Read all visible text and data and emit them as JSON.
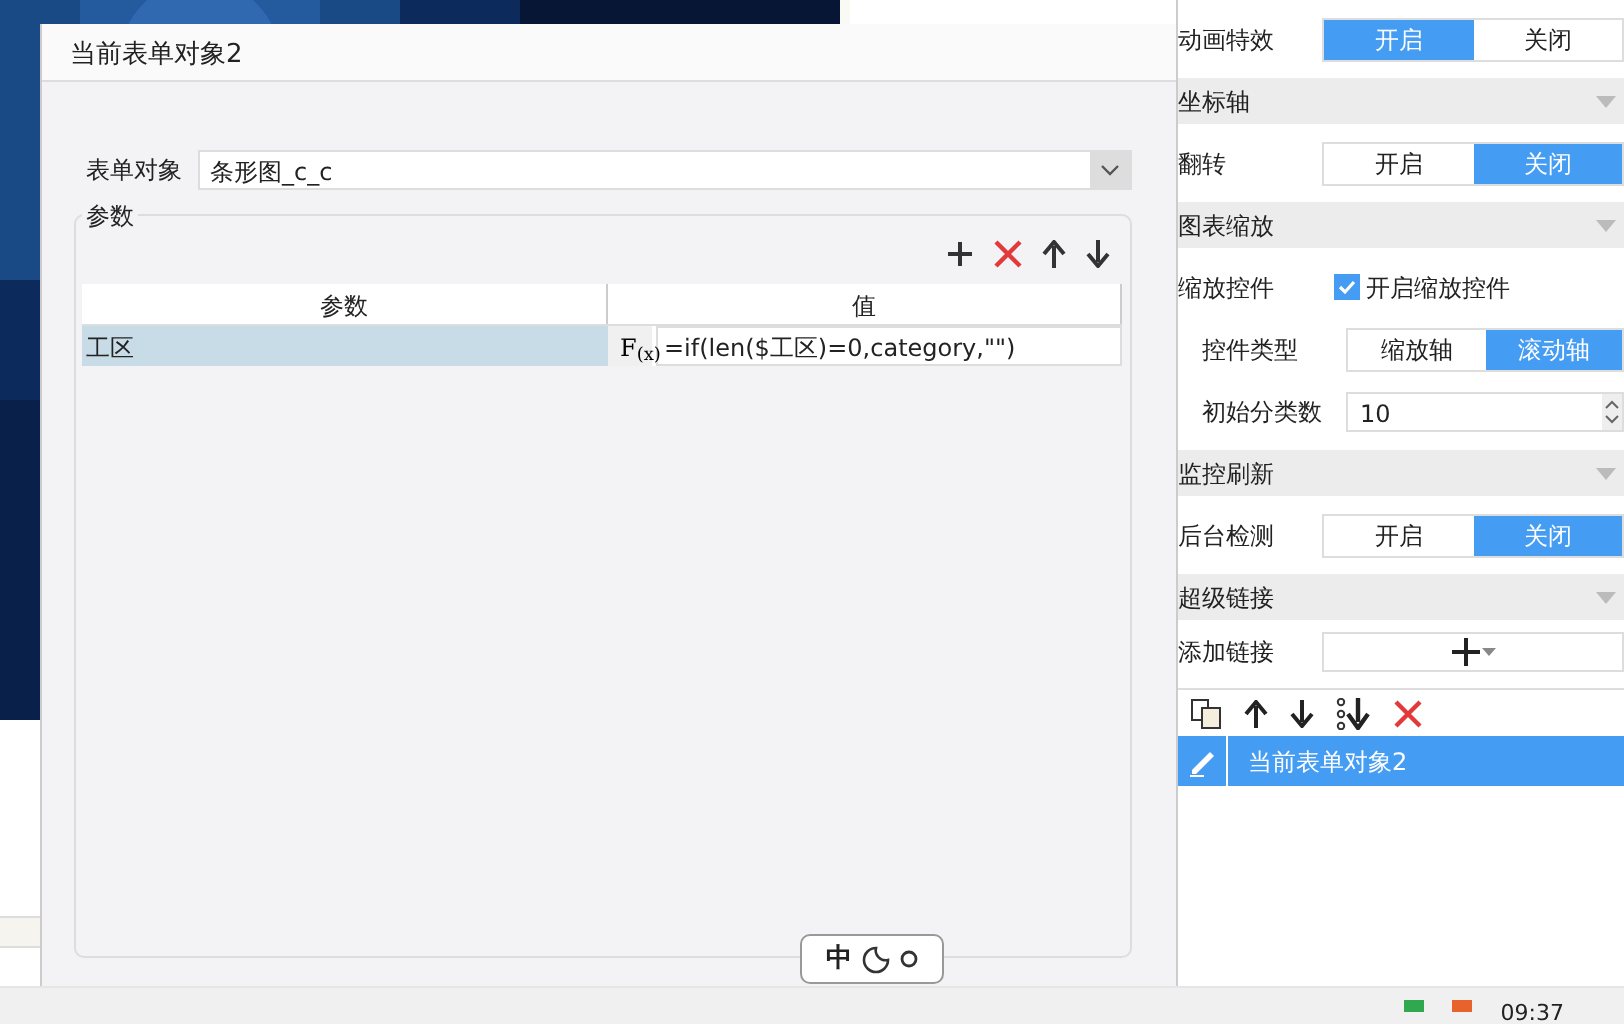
{
  "dialog": {
    "title": "当前表单对象2",
    "form_object": {
      "label": "表单对象",
      "value": "条形图_c_c"
    },
    "params": {
      "legend": "参数",
      "columns": [
        "参数",
        "值"
      ],
      "rows": [
        {
          "name": "工区",
          "selected": true,
          "formula_icon": "F$_{(x)}$",
          "value": "=if(len($工区)=0,category,\"\")"
        }
      ]
    }
  },
  "ime": {
    "mode": "中"
  },
  "panel": {
    "rows": [
      {
        "kind": "segment",
        "label": "动画特效",
        "options": [
          {
            "label": "开启",
            "selected": true
          },
          {
            "label": "关闭",
            "selected": false
          }
        ]
      },
      {
        "kind": "header",
        "label": "坐标轴"
      },
      {
        "kind": "segment",
        "label": "翻转",
        "options": [
          {
            "label": "开启",
            "selected": false
          },
          {
            "label": "关闭",
            "selected": true
          }
        ]
      },
      {
        "kind": "header",
        "label": "图表缩放"
      },
      {
        "kind": "checkbox",
        "label": "缩放控件",
        "checkbox_label": "开启缩放控件",
        "checked": true,
        "children": [
          {
            "kind": "segment",
            "label": "控件类型",
            "options": [
              {
                "label": "缩放轴",
                "selected": false
              },
              {
                "label": "滚动轴",
                "selected": true
              }
            ]
          },
          {
            "kind": "number",
            "label": "初始分类数",
            "value": "10"
          }
        ]
      },
      {
        "kind": "header",
        "label": "监控刷新"
      },
      {
        "kind": "segment",
        "label": "后台检测",
        "options": [
          {
            "label": "开启",
            "selected": false
          },
          {
            "label": "关闭",
            "selected": true
          }
        ]
      },
      {
        "kind": "header",
        "label": "超级链接"
      },
      {
        "kind": "add-link",
        "label": "添加链接"
      }
    ],
    "links": [
      {
        "label": "当前表单对象2",
        "selected": true
      }
    ]
  },
  "taskbar": {
    "clock": "09:37"
  }
}
